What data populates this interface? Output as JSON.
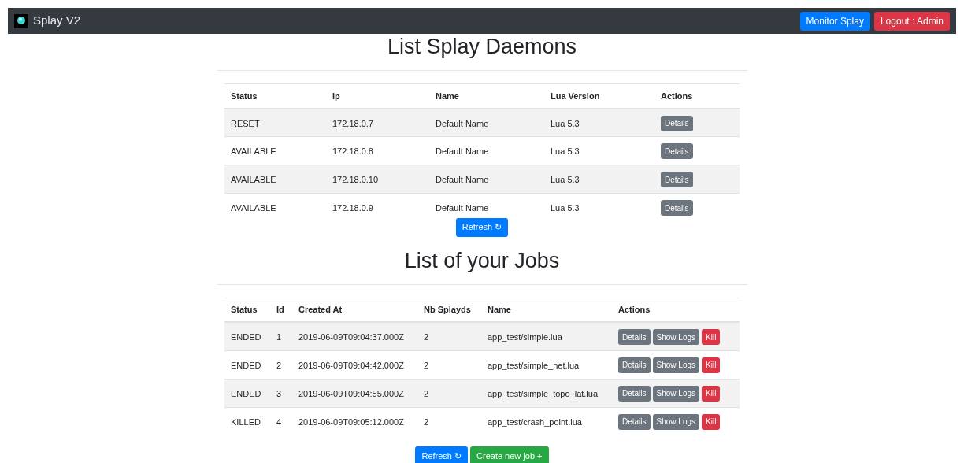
{
  "navbar": {
    "brand": "Splay V2",
    "buttons": [
      {
        "label": "Monitor Splay",
        "kind": "primary"
      },
      {
        "label": "Logout : Admin",
        "kind": "danger"
      }
    ]
  },
  "daemons": {
    "title": "List Splay Daemons",
    "columns": [
      "Status",
      "Ip",
      "Name",
      "Lua Version",
      "Actions"
    ],
    "rows": [
      {
        "status": "RESET",
        "ip": "172.18.0.7",
        "name": "Default Name",
        "lua_version": "Lua 5.3",
        "actions": [
          {
            "label": "Details",
            "kind": "secondary"
          }
        ]
      },
      {
        "status": "AVAILABLE",
        "ip": "172.18.0.8",
        "name": "Default Name",
        "lua_version": "Lua 5.3",
        "actions": [
          {
            "label": "Details",
            "kind": "secondary"
          }
        ]
      },
      {
        "status": "AVAILABLE",
        "ip": "172.18.0.10",
        "name": "Default Name",
        "lua_version": "Lua 5.3",
        "actions": [
          {
            "label": "Details",
            "kind": "secondary"
          }
        ]
      },
      {
        "status": "AVAILABLE",
        "ip": "172.18.0.9",
        "name": "Default Name",
        "lua_version": "Lua 5.3",
        "actions": [
          {
            "label": "Details",
            "kind": "secondary"
          }
        ]
      }
    ],
    "buttons": [
      {
        "label": "Refresh ↻",
        "kind": "primary"
      }
    ]
  },
  "jobs": {
    "title": "List of your Jobs",
    "columns": [
      "Status",
      "Id",
      "Created At",
      "Nb Splayds",
      "Name",
      "Actions"
    ],
    "rows": [
      {
        "status": "ENDED",
        "id": "1",
        "created_at": "2019-06-09T09:04:37.000Z",
        "nb_splayds": "2",
        "name": "app_test/simple.lua",
        "actions": [
          {
            "label": "Details",
            "kind": "secondary"
          },
          {
            "label": "Show Logs",
            "kind": "secondary"
          },
          {
            "label": "Kill",
            "kind": "danger"
          }
        ]
      },
      {
        "status": "ENDED",
        "id": "2",
        "created_at": "2019-06-09T09:04:42.000Z",
        "nb_splayds": "2",
        "name": "app_test/simple_net.lua",
        "actions": [
          {
            "label": "Details",
            "kind": "secondary"
          },
          {
            "label": "Show Logs",
            "kind": "secondary"
          },
          {
            "label": "Kill",
            "kind": "danger"
          }
        ]
      },
      {
        "status": "ENDED",
        "id": "3",
        "created_at": "2019-06-09T09:04:55.000Z",
        "nb_splayds": "2",
        "name": "app_test/simple_topo_lat.lua",
        "actions": [
          {
            "label": "Details",
            "kind": "secondary"
          },
          {
            "label": "Show Logs",
            "kind": "secondary"
          },
          {
            "label": "Kill",
            "kind": "danger"
          }
        ]
      },
      {
        "status": "KILLED",
        "id": "4",
        "created_at": "2019-06-09T09:05:12.000Z",
        "nb_splayds": "2",
        "name": "app_test/crash_point.lua",
        "actions": [
          {
            "label": "Details",
            "kind": "secondary"
          },
          {
            "label": "Show Logs",
            "kind": "secondary"
          },
          {
            "label": "Kill",
            "kind": "danger"
          }
        ]
      }
    ],
    "buttons": [
      {
        "label": "Refresh ↻",
        "kind": "primary"
      },
      {
        "label": "Create new job +",
        "kind": "success"
      }
    ]
  }
}
